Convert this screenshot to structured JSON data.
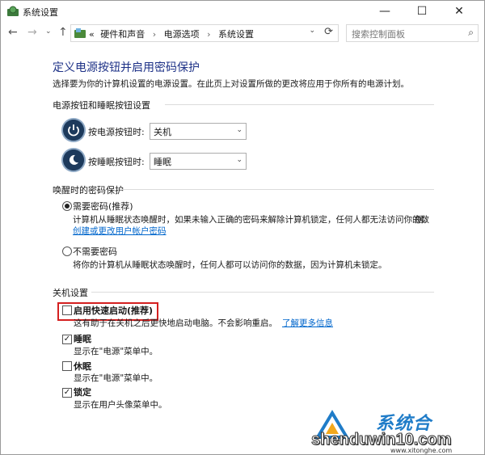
{
  "window": {
    "title": "系统设置",
    "minimize": "—",
    "maximize": "☐",
    "close": "✕"
  },
  "nav": {
    "back": "←",
    "forward": "→",
    "dropdown": "⌄",
    "up": "↑"
  },
  "address": {
    "overflow": "«",
    "crumbs": [
      "硬件和声音",
      "电源选项",
      "系统设置"
    ],
    "separator": "›",
    "refresh": "⟳",
    "dropdown": "⌄"
  },
  "search": {
    "placeholder": "搜索控制面板",
    "icon": "⌕"
  },
  "page": {
    "heading": "定义电源按钮并启用密码保护",
    "description": "选择要为你的计算机设置的电源设置。在此页上对设置所做的更改将应用于你所有的电源计划。"
  },
  "buttons_group": {
    "title": "电源按钮和睡眠按钮设置",
    "power_label": "按电源按钮时:",
    "power_value": "关机",
    "sleep_label": "按睡眠按钮时:",
    "sleep_value": "睡眠"
  },
  "password_group": {
    "title": "唤醒时的密码保护",
    "require_title": "需要密码(推荐)",
    "require_text1": "计算机从睡眠状态唤醒时，如果未输入正确的密码来解除计算机锁定，任何人都无法访问你的数",
    "require_text2": "据。",
    "require_link": "创建或更改用户帐户密码",
    "norequire_title": "不需要密码",
    "norequire_text": "将你的计算机从睡眠状态唤醒时，任何人都可以访问你的数据，因为计算机未锁定。"
  },
  "shutdown_group": {
    "title": "关机设置",
    "fast_label": "启用快速启动(推荐)",
    "fast_desc": "这有助于在关机之后更快地启动电脑。不会影响重启。",
    "fast_link": "了解更多信息",
    "sleep_label": "睡眠",
    "sleep_desc": "显示在\"电源\"菜单中。",
    "hibernate_label": "休眠",
    "hibernate_desc": "显示在\"电源\"菜单中。",
    "lock_label": "锁定",
    "lock_desc": "显示在用户头像菜单中。"
  },
  "checkbox_mark": "✓",
  "dropdown_arrow": "⌄",
  "watermark": {
    "cn": "系统合",
    "big": "shenduwin10.com",
    "small": "www.xitonghe.com"
  }
}
